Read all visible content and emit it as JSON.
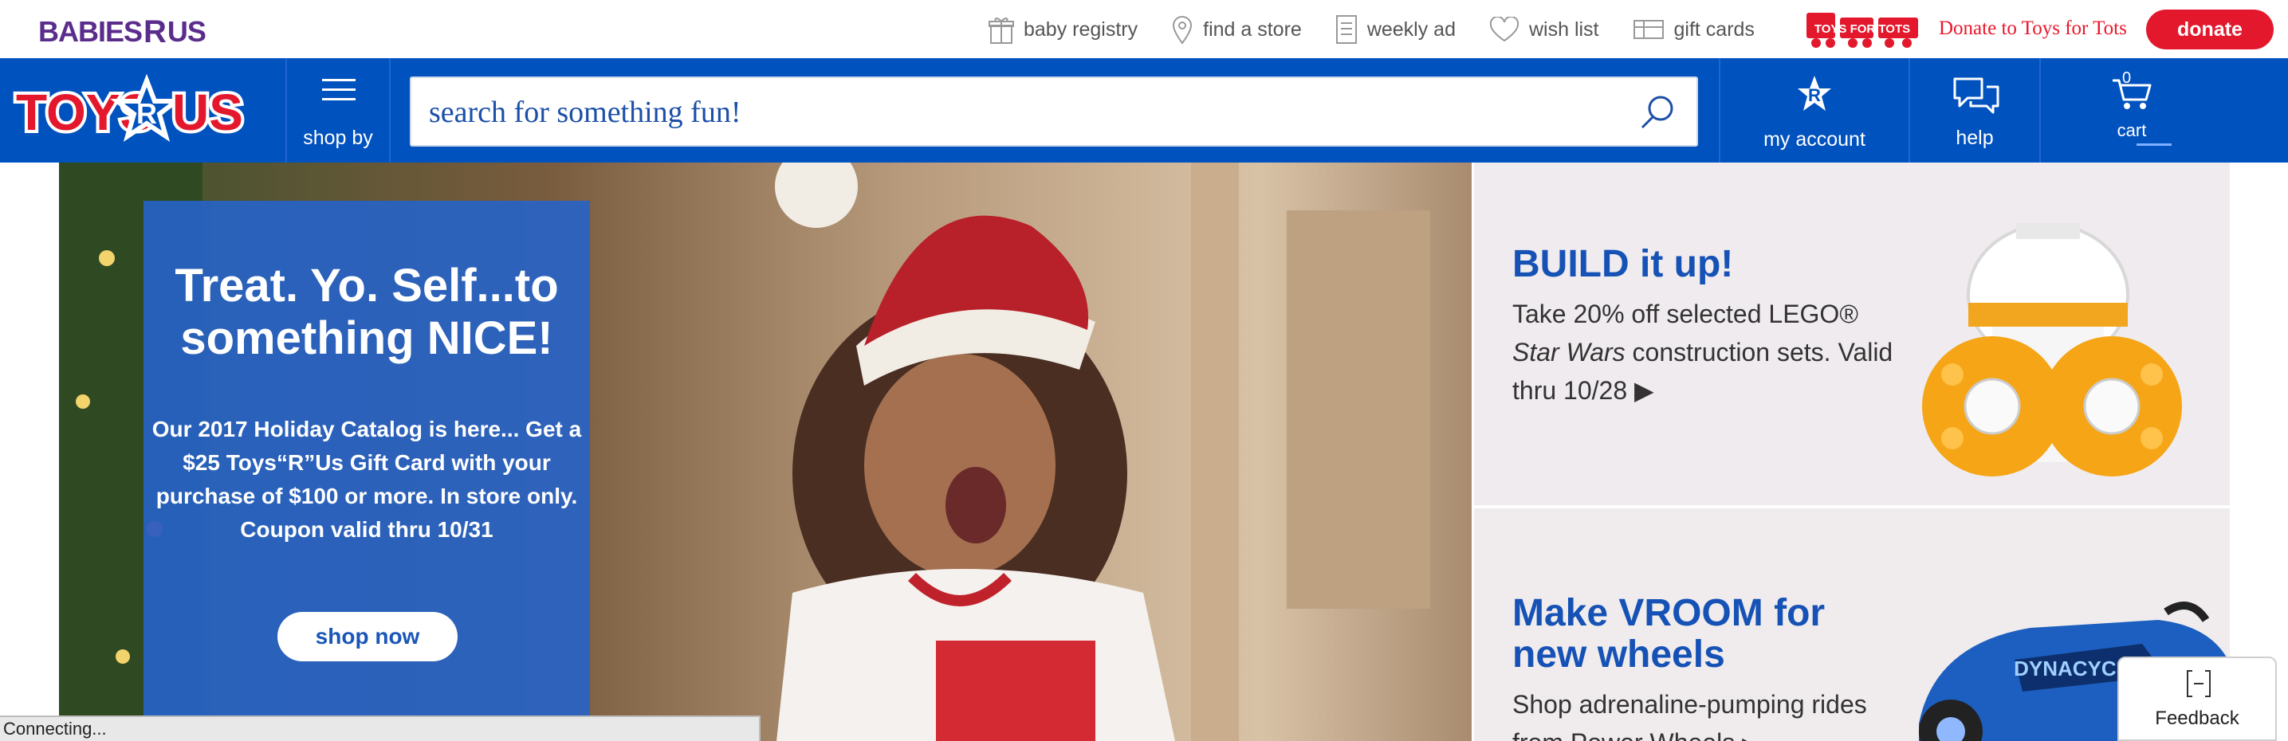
{
  "utility_bar": {
    "brand_logo": {
      "parts": [
        "BABIES",
        "R",
        "US"
      ]
    },
    "links": [
      {
        "label": "baby registry",
        "icon": "gift-icon"
      },
      {
        "label": "find a store",
        "icon": "map-pin-icon"
      },
      {
        "label": "weekly ad",
        "icon": "document-icon"
      },
      {
        "label": "wish list",
        "icon": "heart-icon"
      },
      {
        "label": "gift cards",
        "icon": "gift-card-icon"
      }
    ],
    "toys_for_tots_logo": "TOYS FOR TOTS",
    "donate_text": "Donate to Toys for Tots",
    "donate_button": "donate"
  },
  "header": {
    "logo_parts": [
      "TOYS",
      "R",
      "US"
    ],
    "shop_by_label": "shop by",
    "search": {
      "placeholder": "search for something fun!"
    },
    "my_account_label": "my account",
    "help_label": "help",
    "cart_label": "cart",
    "cart_count": "0"
  },
  "hero": {
    "title": "Treat. Yo. Self...to something NICE!",
    "body": "Our 2017 Holiday Catalog is here... Get a $25 Toys“R”Us Gift Card with your purchase of $100 or more. In store only. Coupon valid thru 10/31",
    "cta": "shop now"
  },
  "promos": [
    {
      "title": "BUILD it up!",
      "text_before": "Take 20% off selected LEGO®",
      "text_italic": "Star Wars",
      "text_after": "construction sets. Valid thru 10/28 ▶"
    },
    {
      "title": "Make VROOM for new wheels",
      "text": "Shop adrenaline-pumping rides from Power Wheels ▸"
    }
  ],
  "status_bar": "Connecting...",
  "feedback": {
    "label": "Feedback",
    "icon": "collapse-icon"
  },
  "colors": {
    "brand_blue": "#0052bf",
    "donate_red": "#e3182d",
    "babies_purple": "#5a2d8c"
  }
}
